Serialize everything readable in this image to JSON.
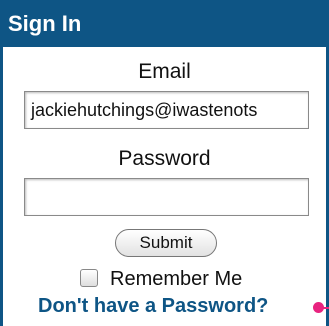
{
  "header": {
    "title": "Sign In"
  },
  "email": {
    "label": "Email",
    "value": "jackiehutchings@iwastenots"
  },
  "password": {
    "label": "Password",
    "value": ""
  },
  "submit": {
    "label": "Submit"
  },
  "remember": {
    "label": "Remember Me",
    "checked": false
  },
  "links": {
    "no_password": "Don't have a Password?"
  },
  "colors": {
    "brand": "#0e5585",
    "accent": "#e8237f"
  }
}
